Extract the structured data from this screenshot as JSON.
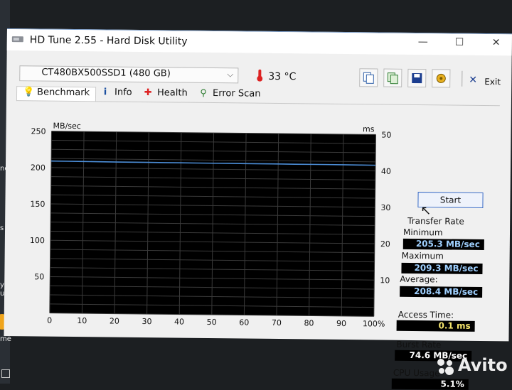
{
  "window": {
    "title": "HD Tune 2.55 - Hard Disk Utility",
    "minimize_glyph": "—",
    "maximize_glyph": "☐",
    "close_glyph": "✕"
  },
  "desktop_edge": {
    "texts": [
      "ne",
      "s",
      "ybo",
      "ut",
      "me"
    ]
  },
  "toolbar": {
    "drive": "CT480BX500SSD1 (480 GB)",
    "temperature": "33 °C",
    "buttons": [
      "copy-text-icon",
      "copy-screenshot-icon",
      "save-icon",
      "options-icon"
    ],
    "exit_label": "Exit"
  },
  "tabs": [
    {
      "label": "Benchmark",
      "icon": "bulb-icon",
      "active": true
    },
    {
      "label": "Info",
      "icon": "info-icon"
    },
    {
      "label": "Health",
      "icon": "health-cross-icon"
    },
    {
      "label": "Error Scan",
      "icon": "magnifier-icon"
    }
  ],
  "chart_data": {
    "type": "line",
    "ylabel": "MB/sec",
    "y2label": "ms",
    "ylim": [
      0,
      250
    ],
    "y2lim": [
      0,
      50
    ],
    "yticks": [
      "250",
      "200",
      "150",
      "100",
      "50"
    ],
    "y2ticks": [
      "50",
      "40",
      "30",
      "20",
      "10"
    ],
    "xticks": [
      "0",
      "10",
      "20",
      "30",
      "40",
      "50",
      "60",
      "70",
      "80",
      "90",
      "100%"
    ],
    "grid": true,
    "series": [
      {
        "values_x": [
          0,
          5,
          10,
          15,
          20,
          25,
          30,
          35,
          40,
          45,
          50,
          55,
          60,
          65,
          70,
          75,
          80,
          85,
          90,
          95,
          100
        ],
        "values_y": [
          209,
          208.9,
          208.8,
          208.7,
          208.6,
          208.5,
          208.5,
          208.4,
          208.4,
          208.3,
          208.3,
          208.3,
          208.2,
          208.2,
          208.2,
          208.1,
          208.1,
          208.1,
          208.0,
          207.9,
          207.8
        ],
        "color": "#4c8ed8"
      }
    ]
  },
  "controls": {
    "start_label": "Start"
  },
  "stats": {
    "transfer_rate_title": "Transfer Rate",
    "minimum_label": "Minimum",
    "minimum": "205.3 MB/sec",
    "maximum_label": "Maximum",
    "maximum": "209.3 MB/sec",
    "average_label": "Average:",
    "average": "208.4 MB/sec",
    "access_time_label": "Access Time:",
    "access_time": "0.1 ms",
    "burst_rate_label": "Burst Rate",
    "burst_rate": "74.6 MB/sec",
    "cpu_usage_label": "CPU Usage",
    "cpu_usage": "5.1%"
  },
  "watermark": {
    "text": "Avito"
  },
  "colors": {
    "accent": "#3b6cc5",
    "graph_bg": "#000000",
    "grid": "#3a3a3a",
    "line": "#4c8ed8"
  }
}
